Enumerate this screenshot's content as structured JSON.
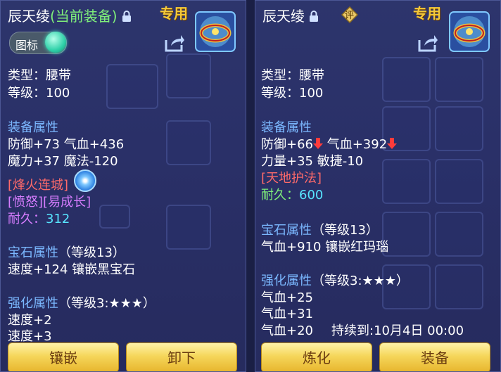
{
  "left": {
    "title_main": "辰天绫",
    "title_suffix": "(当前装备)",
    "zhuanyong": "专用",
    "toggle_label": "图标",
    "type_line": "类型：腰带",
    "level_line": "等级：100",
    "equip_attr_header": "装备属性",
    "attr_line1": "防御+73 气血+436",
    "attr_line2": "魔力+37 魔法-120",
    "special1": "[烽火连城]",
    "special2": "[愤怒][易成长]",
    "durability_label": "耐久：",
    "durability_value": "312",
    "gem_header": "宝石属性",
    "gem_level": "（等级13）",
    "gem_line": "速度+124 镶嵌黑宝石",
    "enhance_header": "强化属性",
    "enhance_level": "（等级3:★★★）",
    "enhance_line1": "速度+2",
    "enhance_line2": "速度+3",
    "btn1": "镶嵌",
    "btn2": "卸下"
  },
  "right": {
    "title_main": "辰天绫",
    "ping": "评",
    "zhuanyong": "专用",
    "type_line": "类型：腰带",
    "level_line": "等级：100",
    "equip_attr_header": "装备属性",
    "attr1a": "防御+66",
    "attr1b": " 气血+392",
    "attr_line2": "力量+35 敏捷-10",
    "special1": "[天地护法]",
    "durability_label": "耐久：",
    "durability_value": "600",
    "gem_header": "宝石属性",
    "gem_level": "（等级13）",
    "gem_line": "气血+910 镶嵌红玛瑙",
    "enhance_header": "强化属性",
    "enhance_level": "（等级3:★★★）",
    "enhance_line1": "气血+25",
    "enhance_line2": "气血+31",
    "enhance_line3": "气血+20",
    "expire": "持续到:10月4日 00:00",
    "btn1": "炼化",
    "btn2": "装备"
  },
  "colors": {
    "section_header": "#7bb8ff",
    "special_red": "#ff6a6a",
    "special_purple": "#d77dff",
    "durability": "#58e5ff",
    "title_green": "#7ff07a",
    "zhuanyong_gold": "#f3c93a"
  },
  "icons": [
    "lock-icon",
    "share-icon",
    "belt-item-icon",
    "down-arrow-icon",
    "rate-badge-icon",
    "swirl-icon"
  ]
}
